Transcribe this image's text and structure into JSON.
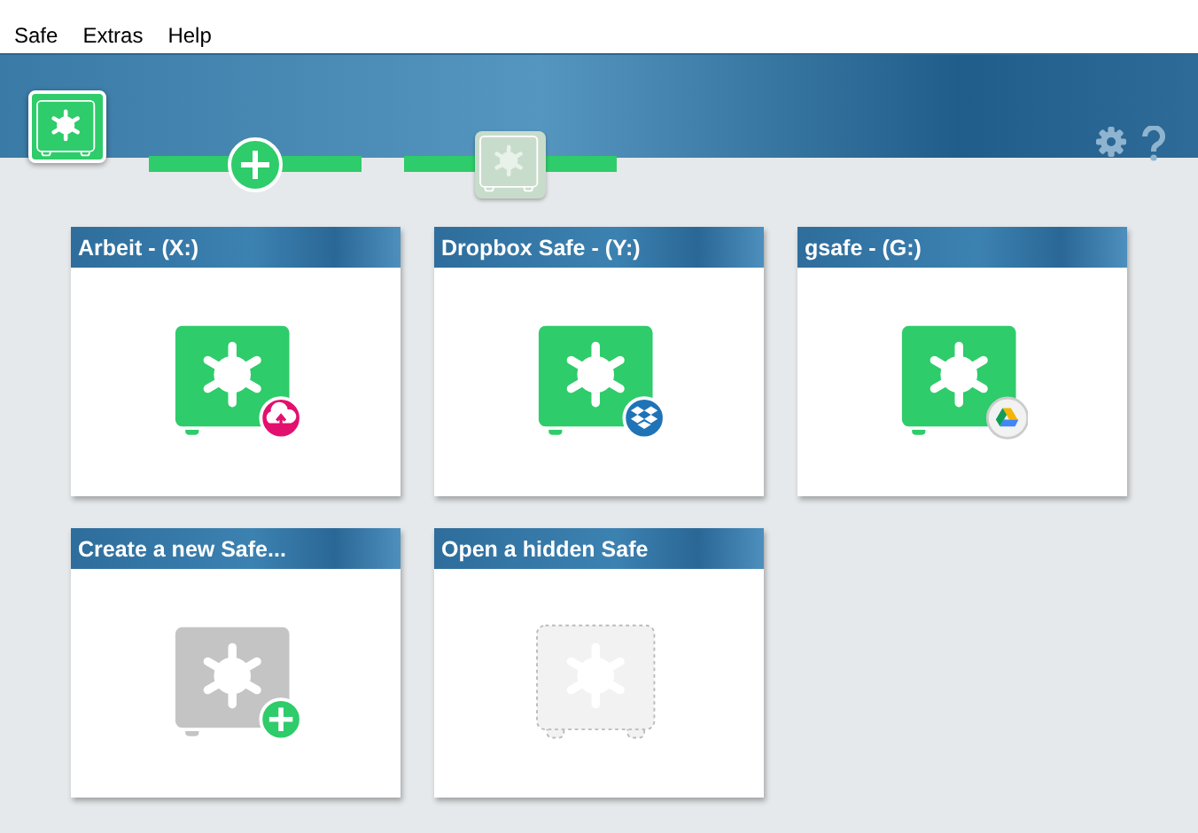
{
  "menu": [
    "Safe",
    "Extras",
    "Help"
  ],
  "safes": [
    {
      "title": "Arbeit - (X:)",
      "kind": "safe",
      "badge": {
        "kind": "cloud"
      }
    },
    {
      "title": "Dropbox Safe - (Y:)",
      "kind": "safe",
      "badge": {
        "kind": "dropbox"
      }
    },
    {
      "title": "gsafe - (G:)",
      "kind": "safe",
      "badge": {
        "kind": "drive"
      }
    },
    {
      "title": "Create a new Safe...",
      "kind": "create"
    },
    {
      "title": "Open a hidden Safe",
      "kind": "hidden"
    }
  ]
}
